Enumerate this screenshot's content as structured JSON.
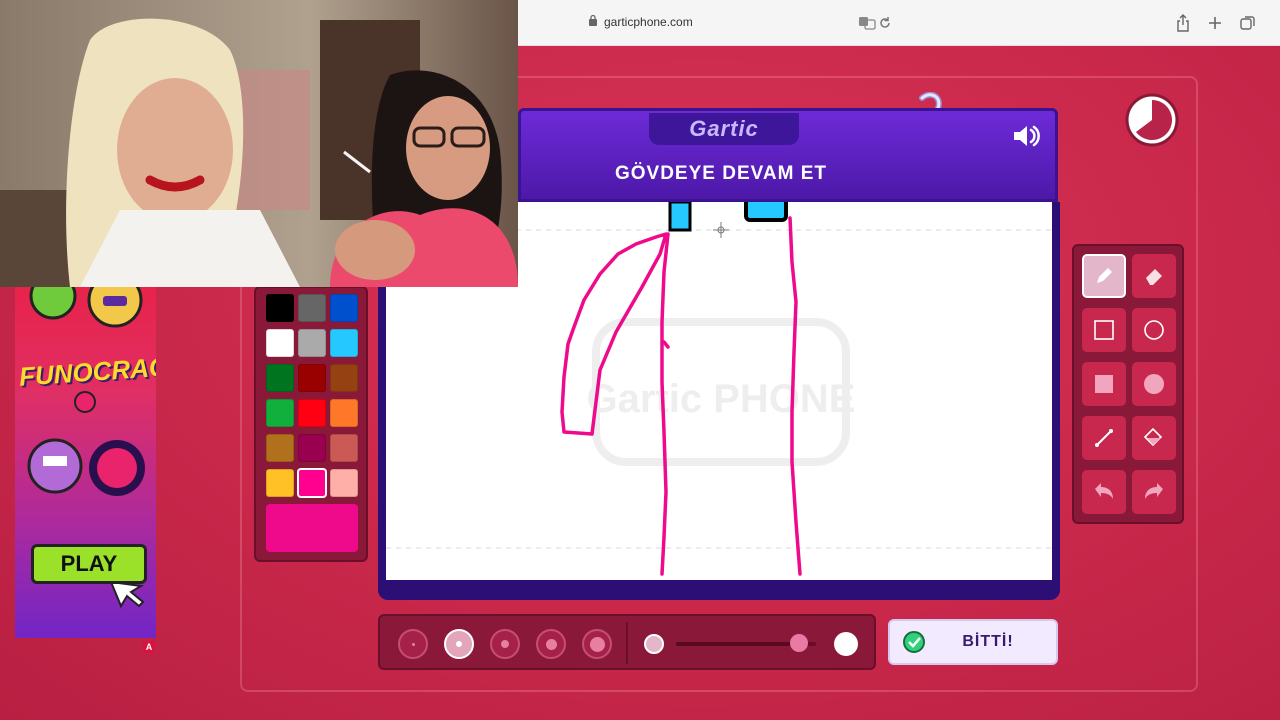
{
  "browser": {
    "url": "garticphone.com",
    "icons": [
      "lock-icon",
      "translate-icon",
      "reload-icon",
      "share-icon",
      "new-tab-icon",
      "tabs-icon"
    ]
  },
  "game": {
    "logo": "Gartic",
    "prompt": "GÖVDEYE DEVAM ET",
    "watermark": "Gartic PHONE",
    "done_label": "BİTTİ!",
    "selected_color": "#ee0a8a",
    "palette": [
      "#000000",
      "#666666",
      "#0050cd",
      "#ffffff",
      "#aaaaaa",
      "#26c9ff",
      "#017420",
      "#990000",
      "#964112",
      "#11b03c",
      "#ff0013",
      "#ff7829",
      "#b0701c",
      "#99004e",
      "#cb5a57",
      "#ffc126",
      "#ff008f",
      "#feafa8"
    ],
    "tools": [
      "pencil-icon",
      "eraser-icon",
      "rectangle-outline-icon",
      "circle-outline-icon",
      "rectangle-fill-icon",
      "circle-fill-icon",
      "line-icon",
      "bucket-icon",
      "undo-icon",
      "redo-icon"
    ],
    "brush_sizes": 5,
    "selected_brush_index": 1,
    "opacity_level": 0.88
  },
  "ad": {
    "brand": "FUNOCRACY",
    "play_label": "PLAY",
    "badge": "A"
  }
}
